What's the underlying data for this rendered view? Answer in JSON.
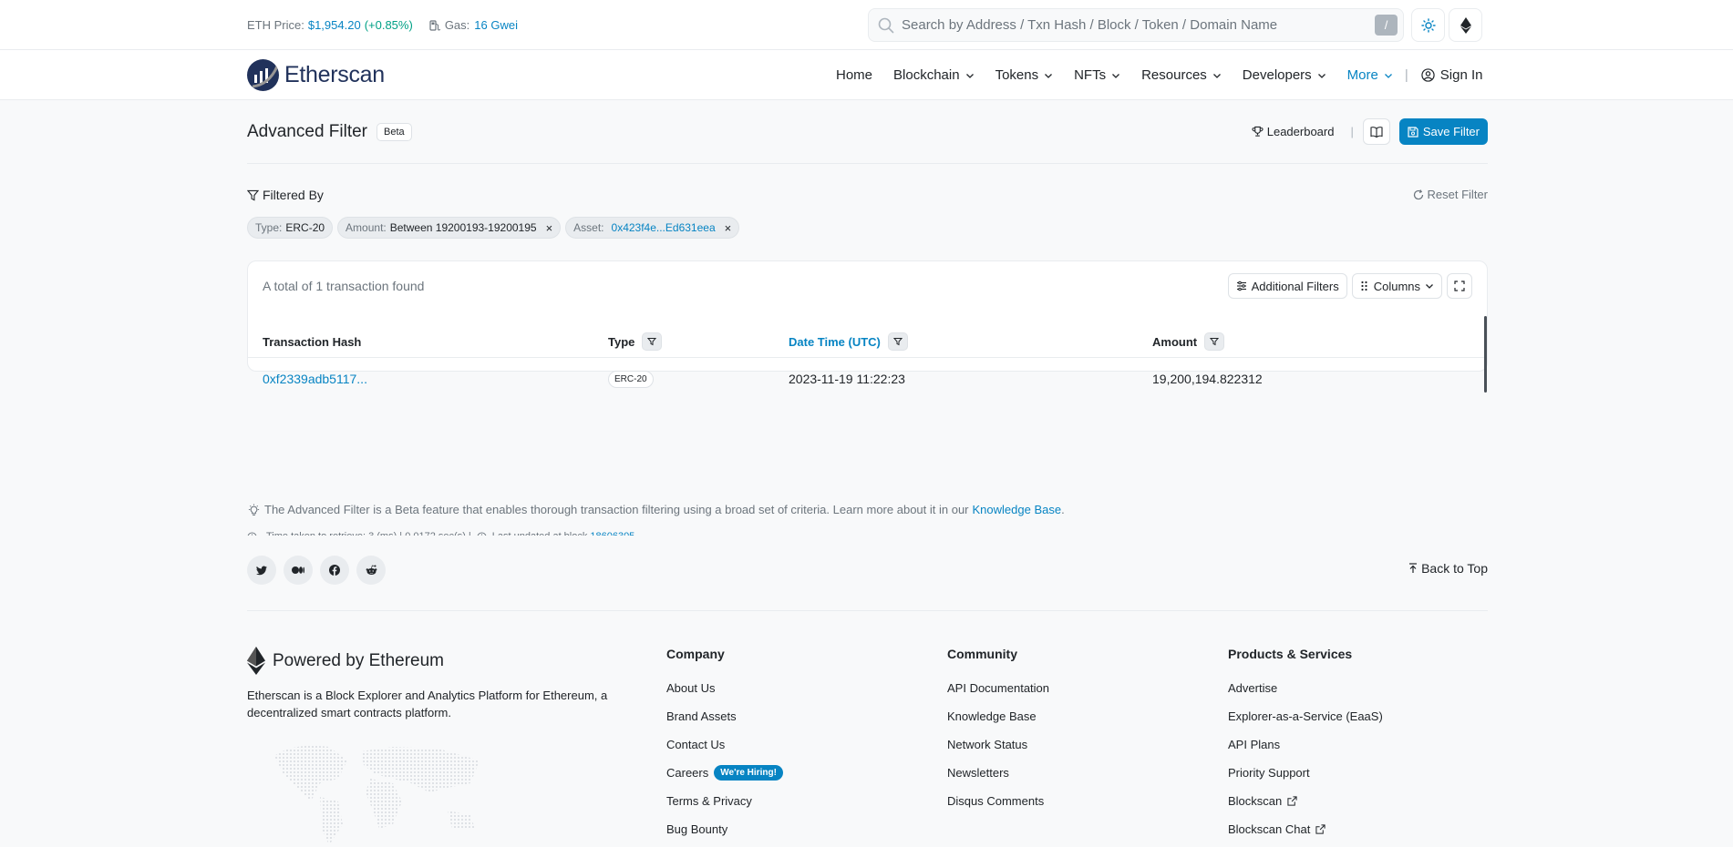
{
  "topbar": {
    "eth_price_label": "ETH Price:",
    "eth_price_value": "$1,954.20",
    "eth_price_change": "(+0.85%)",
    "gas_label": "Gas:",
    "gas_value": "16 Gwei",
    "search_placeholder": "Search by Address / Txn Hash / Block / Token / Domain Name",
    "search_shortcut": "/"
  },
  "nav": {
    "logo_text": "Etherscan",
    "items": [
      {
        "label": "Home"
      },
      {
        "label": "Blockchain"
      },
      {
        "label": "Tokens"
      },
      {
        "label": "NFTs"
      },
      {
        "label": "Resources"
      },
      {
        "label": "Developers"
      },
      {
        "label": "More"
      }
    ],
    "sign_in": "Sign In"
  },
  "page": {
    "title": "Advanced Filter",
    "beta_badge": "Beta",
    "leaderboard": "Leaderboard",
    "save_filter": "Save Filter",
    "filtered_by": "Filtered By",
    "reset_filter": "Reset Filter",
    "chips": [
      {
        "label": "Type:",
        "value": "ERC-20"
      },
      {
        "label": "Amount:",
        "value": "Between 19200193-19200195"
      },
      {
        "label": "Asset:",
        "value": "0x423f4e...Ed631eea"
      }
    ]
  },
  "results": {
    "total_text": "A total of 1 transaction found",
    "additional_filters": "Additional Filters",
    "columns": "Columns",
    "headers": [
      "Transaction Hash",
      "Type",
      "Date Time (UTC)",
      "Amount"
    ],
    "rows": [
      {
        "hash": "0xf2339adb5117...",
        "type": "ERC-20",
        "datetime": "2023-11-19 11:22:23",
        "amount": "19,200,194.822312"
      }
    ]
  },
  "notes": {
    "beta_text": "The Advanced Filter is a Beta feature that enables thorough transaction filtering using a broad set of criteria. Learn more about it in our",
    "kb_link": "Knowledge Base",
    "kb_period": ".",
    "time_taken": "Time taken to retrieve: 3 (ms) | 0.0172 sec(s) |",
    "last_updated": "Last updated at block",
    "block": "18606305"
  },
  "footer": {
    "back_to_top": "Back to Top",
    "powered_by": "Powered by Ethereum",
    "description": "Etherscan is a Block Explorer and Analytics Platform for Ethereum, a decentralized smart contracts platform.",
    "company": {
      "title": "Company",
      "links": [
        "About Us",
        "Brand Assets",
        "Contact Us",
        "Careers",
        "Terms & Privacy",
        "Bug Bounty"
      ],
      "hiring_badge": "We're Hiring!"
    },
    "community": {
      "title": "Community",
      "links": [
        "API Documentation",
        "Knowledge Base",
        "Network Status",
        "Newsletters",
        "Disqus Comments"
      ]
    },
    "products": {
      "title": "Products & Services",
      "links": [
        "Advertise",
        "Explorer-as-a-Service (EaaS)",
        "API Plans",
        "Priority Support",
        "Blockscan",
        "Blockscan Chat"
      ]
    }
  },
  "colors": {
    "accent": "#0784c3",
    "positive": "#00a186",
    "brand_dark": "#21325b"
  }
}
